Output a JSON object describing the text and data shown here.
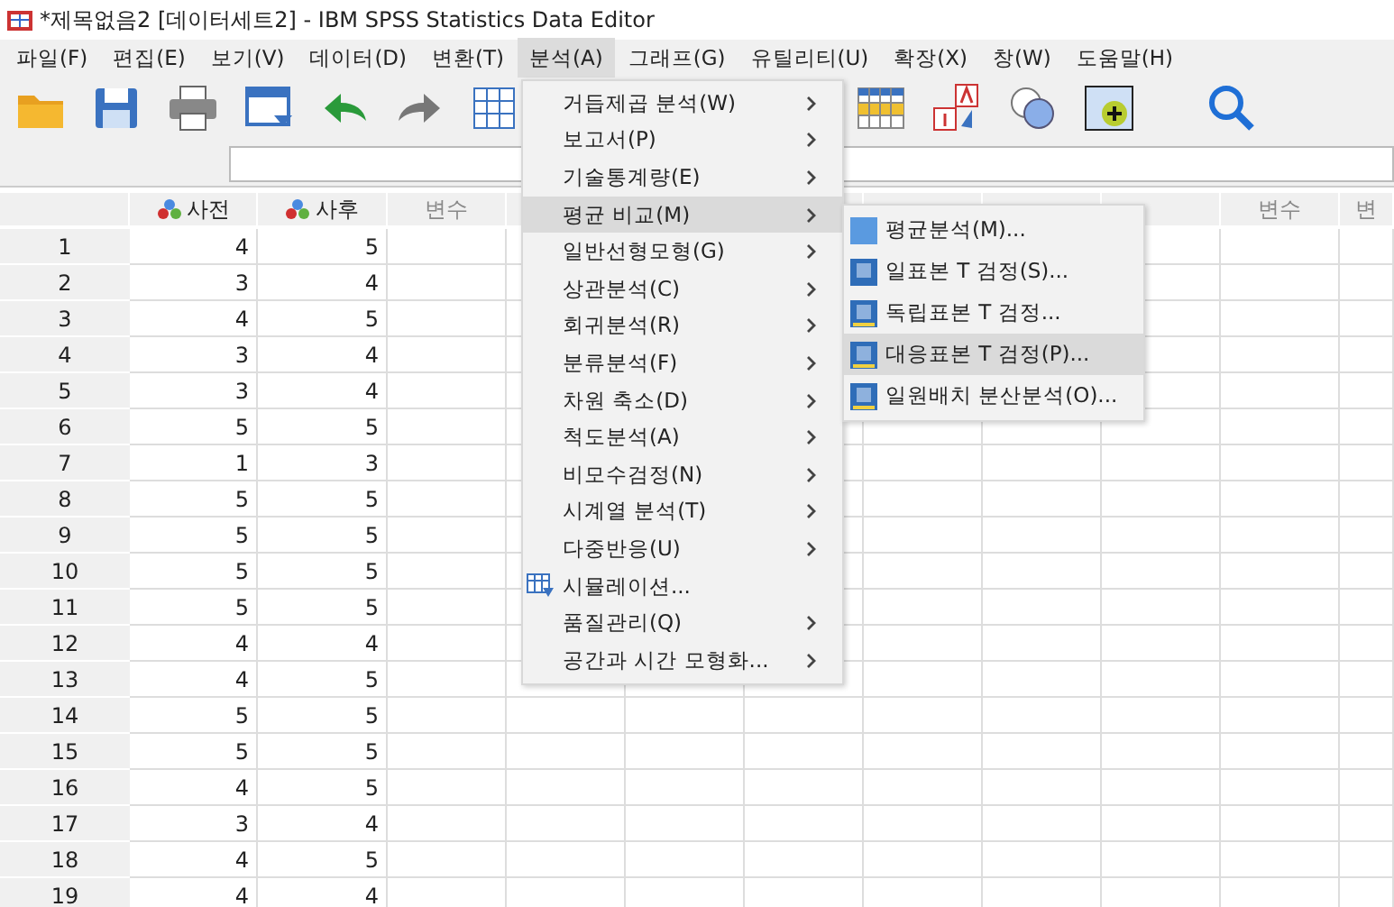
{
  "window": {
    "title": "*제목없음2 [데이터세트2] - IBM SPSS Statistics Data Editor"
  },
  "menubar": [
    {
      "label": "파일(F)",
      "selected": false
    },
    {
      "label": "편집(E)",
      "selected": false
    },
    {
      "label": "보기(V)",
      "selected": false
    },
    {
      "label": "데이터(D)",
      "selected": false
    },
    {
      "label": "변환(T)",
      "selected": false
    },
    {
      "label": "분석(A)",
      "selected": true
    },
    {
      "label": "그래프(G)",
      "selected": false
    },
    {
      "label": "유틸리티(U)",
      "selected": false
    },
    {
      "label": "확장(X)",
      "selected": false
    },
    {
      "label": "창(W)",
      "selected": false
    },
    {
      "label": "도움말(H)",
      "selected": false
    }
  ],
  "columns": [
    {
      "kind": "variable",
      "label": "사전"
    },
    {
      "kind": "variable",
      "label": "사후"
    },
    {
      "kind": "empty",
      "label": "변수"
    },
    {
      "kind": "covered"
    },
    {
      "kind": "covered"
    },
    {
      "kind": "covered"
    },
    {
      "kind": "covered"
    },
    {
      "kind": "covered"
    },
    {
      "kind": "covered"
    },
    {
      "kind": "empty",
      "label": "변수"
    },
    {
      "kind": "empty",
      "label": "변"
    }
  ],
  "rows": [
    {
      "n": "1",
      "values": [
        "4",
        "5"
      ]
    },
    {
      "n": "2",
      "values": [
        "3",
        "4"
      ]
    },
    {
      "n": "3",
      "values": [
        "4",
        "5"
      ]
    },
    {
      "n": "4",
      "values": [
        "3",
        "4"
      ]
    },
    {
      "n": "5",
      "values": [
        "3",
        "4"
      ]
    },
    {
      "n": "6",
      "values": [
        "5",
        "5"
      ]
    },
    {
      "n": "7",
      "values": [
        "1",
        "3"
      ]
    },
    {
      "n": "8",
      "values": [
        "5",
        "5"
      ]
    },
    {
      "n": "9",
      "values": [
        "5",
        "5"
      ]
    },
    {
      "n": "10",
      "values": [
        "5",
        "5"
      ]
    },
    {
      "n": "11",
      "values": [
        "5",
        "5"
      ]
    },
    {
      "n": "12",
      "values": [
        "4",
        "4"
      ]
    },
    {
      "n": "13",
      "values": [
        "4",
        "5"
      ]
    },
    {
      "n": "14",
      "values": [
        "5",
        "5"
      ]
    },
    {
      "n": "15",
      "values": [
        "5",
        "5"
      ]
    },
    {
      "n": "16",
      "values": [
        "4",
        "5"
      ]
    },
    {
      "n": "17",
      "values": [
        "3",
        "4"
      ]
    },
    {
      "n": "18",
      "values": [
        "4",
        "5"
      ]
    },
    {
      "n": "19",
      "values": [
        "4",
        "4"
      ]
    }
  ],
  "analyze_menu": [
    {
      "kind": "submenu",
      "label": "거듭제곱 분석(W)",
      "selected": false
    },
    {
      "kind": "submenu",
      "label": "보고서(P)",
      "selected": false
    },
    {
      "kind": "submenu",
      "label": "기술통계량(E)",
      "selected": false
    },
    {
      "kind": "submenu",
      "label": "평균 비교(M)",
      "selected": true
    },
    {
      "kind": "submenu",
      "label": "일반선형모형(G)",
      "selected": false
    },
    {
      "kind": "submenu",
      "label": "상관분석(C)",
      "selected": false
    },
    {
      "kind": "submenu",
      "label": "회귀분석(R)",
      "selected": false
    },
    {
      "kind": "submenu",
      "label": "분류분석(F)",
      "selected": false
    },
    {
      "kind": "submenu",
      "label": "차원 축소(D)",
      "selected": false
    },
    {
      "kind": "submenu",
      "label": "척도분석(A)",
      "selected": false
    },
    {
      "kind": "submenu",
      "label": "비모수검정(N)",
      "selected": false
    },
    {
      "kind": "submenu",
      "label": "시계열 분석(T)",
      "selected": false
    },
    {
      "kind": "submenu",
      "label": "다중반응(U)",
      "selected": false
    },
    {
      "kind": "action",
      "label": "시뮬레이션...",
      "selected": false
    },
    {
      "kind": "submenu",
      "label": "품질관리(Q)",
      "selected": false
    },
    {
      "kind": "submenu",
      "label": "공간과 시간 모형화...",
      "selected": false
    }
  ],
  "compare_means_menu": [
    {
      "label": "평균분석(M)...",
      "selected": false
    },
    {
      "label": "일표본 T 검정(S)...",
      "selected": false
    },
    {
      "label": "독립표본 T 검정...",
      "selected": false
    },
    {
      "label": "대응표본 T 검정(P)...",
      "selected": true
    },
    {
      "label": "일원배치 분산분석(O)...",
      "selected": false
    }
  ]
}
